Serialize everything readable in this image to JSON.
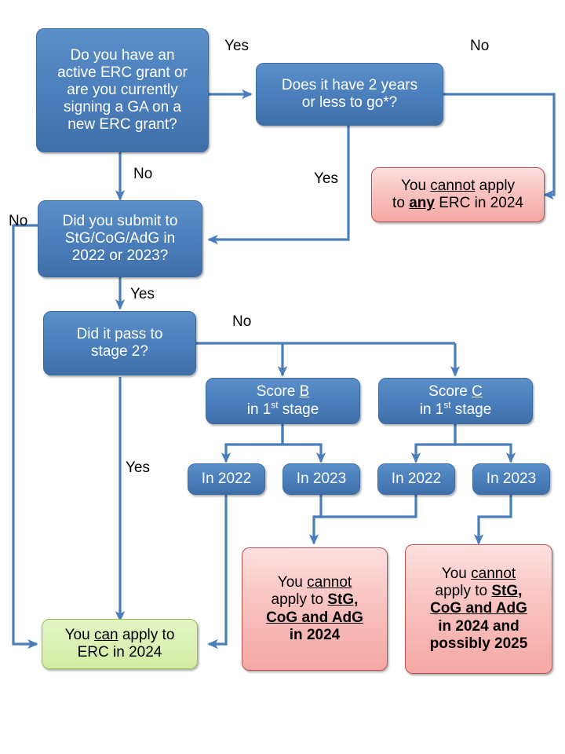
{
  "diagram": {
    "title": "ERC 2024 eligibility decision flowchart",
    "colors": {
      "decision_blue": "#4a7ebb",
      "negative_pink": "#f5a8a4",
      "positive_green": "#d2eca0",
      "connector_blue": "#4a7ebb",
      "text_on_blue": "#ffffff",
      "text_dark": "#000000"
    },
    "nodes": [
      {
        "id": "q-active-grant",
        "kind": "decision",
        "style": "blue",
        "text": "Do you have an active ERC grant or are you currently signing a GA on a new ERC grant?",
        "lines": [
          "Do you have an",
          "active ERC grant or",
          "are you currently",
          "signing a GA on a",
          "new ERC grant?"
        ]
      },
      {
        "id": "q-two-years",
        "kind": "decision",
        "style": "blue",
        "text": "Does it have 2 years or less to go*?",
        "lines": [
          "Does it have 2 years",
          "or less to go*?"
        ]
      },
      {
        "id": "r-cannot-any",
        "kind": "outcome",
        "style": "pink",
        "text": "You cannot apply to any ERC in 2024",
        "lines": [
          "You cannot apply",
          "to any ERC in 2024"
        ]
      },
      {
        "id": "q-submitted",
        "kind": "decision",
        "style": "blue",
        "text": "Did you submit to StG/CoG/AdG in 2022 or 2023?",
        "lines": [
          "Did you submit to",
          "StG/CoG/AdG in",
          "2022 or 2023?"
        ]
      },
      {
        "id": "q-stage2",
        "kind": "decision",
        "style": "blue",
        "text": "Did it pass to stage 2?",
        "lines": [
          "Did it pass to",
          "stage 2?"
        ]
      },
      {
        "id": "score-b",
        "kind": "state",
        "style": "blue",
        "text": "Score B in 1st stage",
        "lines": [
          "Score B",
          "in 1st stage"
        ]
      },
      {
        "id": "score-c",
        "kind": "state",
        "style": "blue",
        "text": "Score C in 1st stage",
        "lines": [
          "Score C",
          "in 1st stage"
        ]
      },
      {
        "id": "b-2022",
        "kind": "state",
        "style": "blue",
        "text": "In 2022"
      },
      {
        "id": "b-2023",
        "kind": "state",
        "style": "blue",
        "text": "In 2023"
      },
      {
        "id": "c-2022",
        "kind": "state",
        "style": "blue",
        "text": "In 2022"
      },
      {
        "id": "c-2023",
        "kind": "state",
        "style": "blue",
        "text": "In 2023"
      },
      {
        "id": "r-can-apply",
        "kind": "outcome",
        "style": "green",
        "text": "You can apply to ERC in 2024",
        "lines": [
          "You can apply to",
          "ERC in 2024"
        ]
      },
      {
        "id": "r-cannot-2024",
        "kind": "outcome",
        "style": "pink",
        "text": "You cannot apply to StG, CoG and AdG in 2024",
        "lines": [
          "You cannot",
          "apply to StG,",
          "CoG and AdG",
          "in 2024"
        ]
      },
      {
        "id": "r-cannot-2024-2025",
        "kind": "outcome",
        "style": "pink",
        "text": "You cannot apply to StG, CoG and AdG in 2024 and possibly 2025",
        "lines": [
          "You cannot",
          "apply to StG,",
          "CoG and AdG",
          "in 2024 and",
          "possibly 2025"
        ]
      }
    ],
    "edge_labels": {
      "active_yes": "Yes",
      "active_no": "No",
      "twoyears_no": "No",
      "twoyears_yes": "Yes",
      "submitted_no": "No",
      "submitted_yes": "Yes",
      "stage2_no": "No",
      "stage2_yes": "Yes"
    },
    "node_text": {
      "q_active_l1": "Do you have an",
      "q_active_l2": "active ERC grant or",
      "q_active_l3": "are you currently",
      "q_active_l4": "signing a GA on a",
      "q_active_l5": "new ERC grant?",
      "q_two_l1": "Does it have 2 years",
      "q_two_l2": "or less to go*?",
      "q_sub_l1": "Did you submit to",
      "q_sub_l2": "StG/CoG/AdG in",
      "q_sub_l3": "2022 or 2023?",
      "q_st2_l1": "Did it pass to",
      "q_st2_l2": "stage 2?",
      "score_word": "Score",
      "score_b_letter": "B",
      "score_c_letter": "C",
      "in_stage_prefix": "in 1",
      "in_stage_sup": "st",
      "in_stage_suffix": "stage",
      "in_2022": "In 2022",
      "in_2023": "In 2023",
      "you_word": "You",
      "cannot_word": "cannot",
      "can_word": "can",
      "apply_word": "apply",
      "apply_to": "apply to",
      "to_word": "to",
      "any_word": "any",
      "erc_2024": "ERC in 2024",
      "erc_in_2024_tail": "ERC in 2024",
      "stg_comma": "StG,",
      "cog_adg": "CoG and AdG",
      "in_2024": "in 2024",
      "in_2024_and": "in 2024 and",
      "possibly_2025": "possibly 2025"
    }
  }
}
